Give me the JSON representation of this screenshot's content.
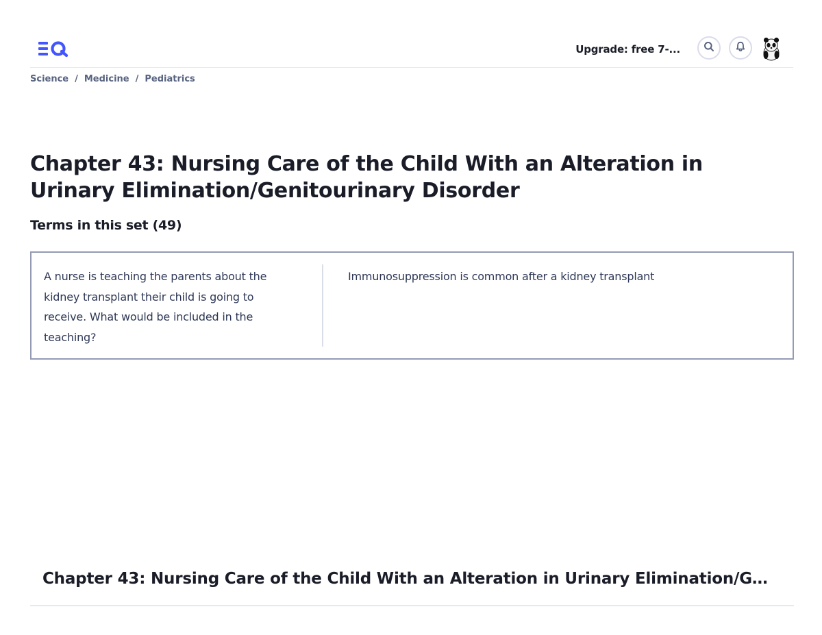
{
  "header": {
    "upgrade_label": "Upgrade: free 7-...",
    "accent_color": "#4255ff"
  },
  "breadcrumb": {
    "items": [
      "Science",
      "Medicine",
      "Pediatrics"
    ],
    "separator": "/"
  },
  "set": {
    "title": "Chapter 43: Nursing Care of the Child With an Alteration in Urinary Elimination/Genitourinary Disorder",
    "terms_heading": "Terms in this set (49)"
  },
  "cards": [
    {
      "term": "A nurse is teaching the parents about the kidney transplant their child is going to receive. What would be included in the teaching?",
      "definition": "Immunosuppression is common after a kidney transplant"
    }
  ],
  "footer": {
    "title": "Chapter 43: Nursing Care of the Child With an Alteration in Urinary Elimination/G..."
  }
}
